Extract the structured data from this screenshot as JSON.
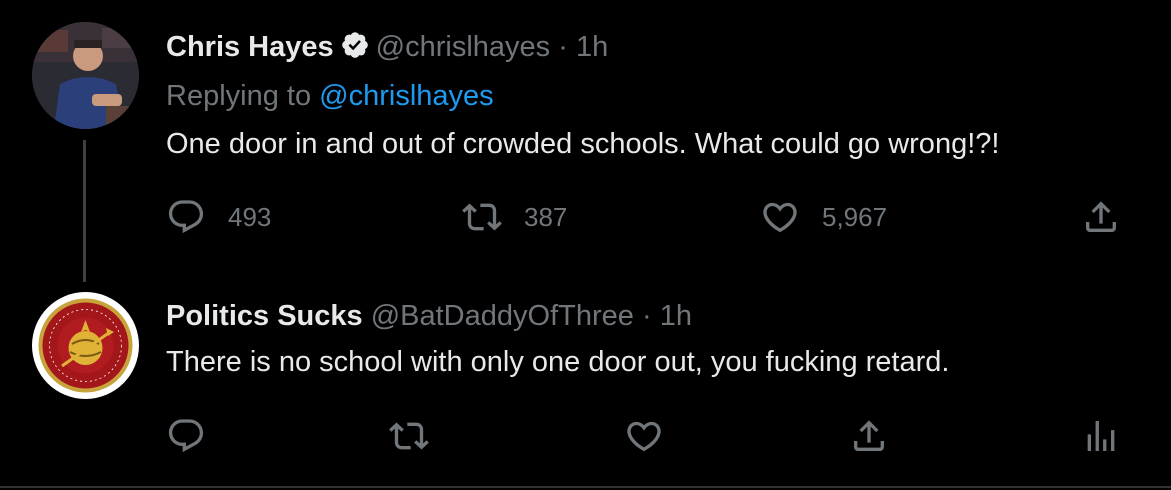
{
  "tweets": [
    {
      "display_name": "Chris Hayes",
      "handle": "@chrislhayes",
      "separator": "·",
      "time": "1h",
      "verified": true,
      "replying_prefix": "Replying to",
      "replying_to": "@chrislhayes",
      "text": "One door in and out of crowded schools. What could go wrong!?!",
      "counts": {
        "replies": "493",
        "retweets": "387",
        "likes": "5,967"
      }
    },
    {
      "display_name": "Politics Sucks",
      "handle": "@BatDaddyOfThree",
      "separator": "·",
      "time": "1h",
      "verified": false,
      "text": "There is no school with only one door out, you fucking retard."
    }
  ],
  "icons": {
    "reply": "reply-icon",
    "retweet": "retweet-icon",
    "like": "heart-icon",
    "share": "share-icon",
    "analytics": "analytics-icon",
    "verified": "verified-badge-icon"
  },
  "colors": {
    "background": "#000000",
    "text": "#e7e9ea",
    "muted": "#71767b",
    "link": "#1d9bf0",
    "thread_line": "#3e4144"
  }
}
